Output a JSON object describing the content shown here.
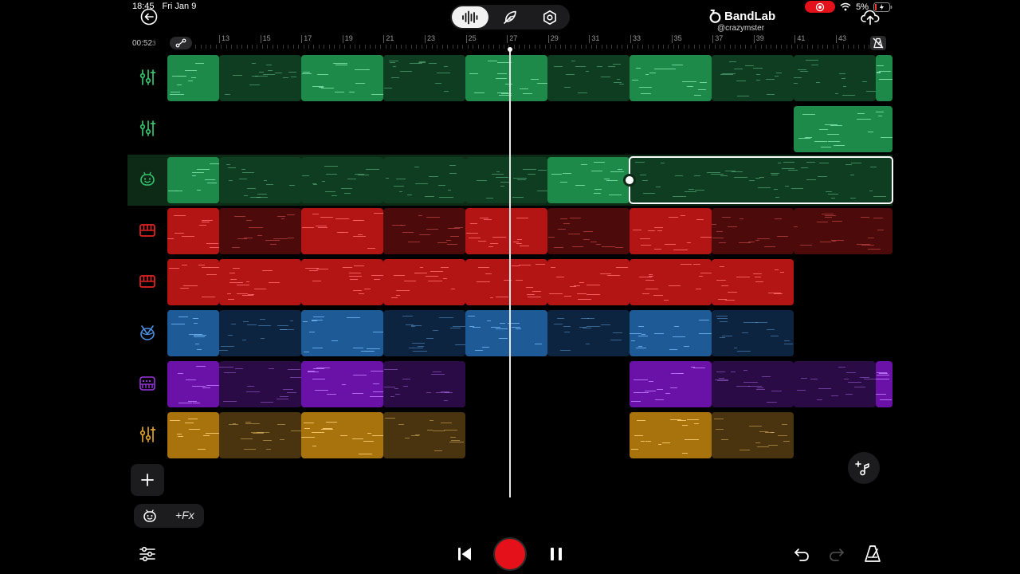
{
  "status_bar": {
    "time": "18:45",
    "date": "Fri Jan 9",
    "battery": "5%",
    "icons": [
      "screen-record-icon",
      "wifi-icon",
      "battery-icon"
    ]
  },
  "header": {
    "brand": "BandLab",
    "user": "@crazymster",
    "mode_buttons": [
      "waveform-icon",
      "feather-icon",
      "settings-hex-icon"
    ],
    "active_mode": "waveform-icon"
  },
  "ruler": {
    "time_readout": "00:52",
    "time_sub": "3",
    "labels": [
      "13",
      "15",
      "17",
      "19",
      "21",
      "23",
      "25",
      "27",
      "29",
      "31",
      "33",
      "35",
      "37",
      "39",
      "41",
      "43"
    ]
  },
  "tracks": [
    {
      "name": "track-1",
      "icon": "mixer-sliders-icon",
      "color": "#1d8a4a",
      "dark": "#0f3d21",
      "note_color": "#7fe3a8"
    },
    {
      "name": "track-2",
      "icon": "mixer-sliders-icon",
      "color": "#1d8a4a",
      "dark": "#0f3d21",
      "note_color": "#7fe3a8"
    },
    {
      "name": "track-3",
      "icon": "voice-face-icon",
      "color": "#1d8a4a",
      "dark": "#0f3d21",
      "note_color": "#7fe3a8",
      "selected": true
    },
    {
      "name": "track-4",
      "icon": "piano-keys-icon",
      "color": "#b31414",
      "dark": "#4d0a0a",
      "note_color": "#ff6a6a"
    },
    {
      "name": "track-5",
      "icon": "piano-keys-icon",
      "color": "#b31414",
      "dark": "#4d0a0a",
      "note_color": "#ff6a6a"
    },
    {
      "name": "track-6",
      "icon": "drum-icon",
      "color": "#1d5a96",
      "dark": "#0d2440",
      "note_color": "#6fb4f0"
    },
    {
      "name": "track-7",
      "icon": "synth-keyboard-icon",
      "color": "#6a12a8",
      "dark": "#2b0b45",
      "note_color": "#c07bff"
    },
    {
      "name": "track-8",
      "icon": "mixer-sliders-icon",
      "color": "#a8720d",
      "dark": "#4a3410",
      "note_color": "#ffd07a"
    }
  ],
  "controls": {
    "fx_label": "+Fx",
    "icons": [
      "add-track-icon",
      "voice-face-icon",
      "add-midi-icon",
      "mixer-icon",
      "skip-back-icon",
      "record-icon",
      "pause-icon",
      "undo-icon",
      "redo-icon",
      "metronome-icon"
    ]
  },
  "colors": {
    "accent_record": "#e4111a",
    "background": "#000000",
    "panel": "#1c1c1e",
    "green_icon": "#37c46f",
    "red_icon": "#e02424",
    "blue_icon": "#4a8fe0",
    "purple_icon": "#9b35e0",
    "gold_icon": "#e0a22a"
  }
}
